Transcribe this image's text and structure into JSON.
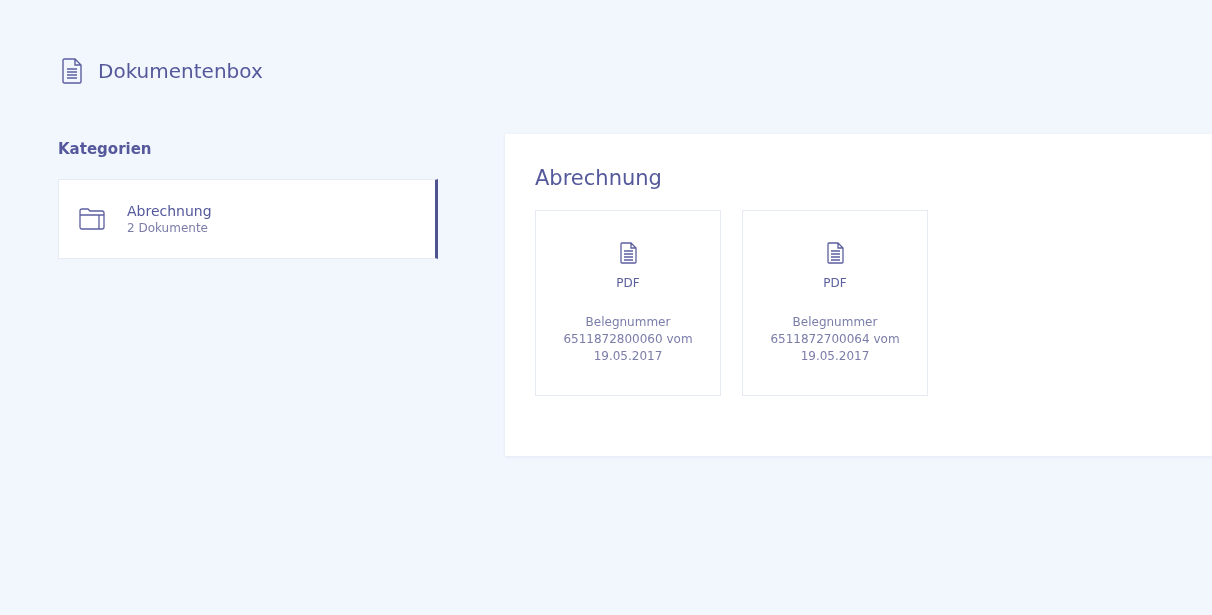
{
  "header": {
    "title": "Dokumentenbox"
  },
  "sidebar": {
    "heading": "Kategorien",
    "categories": [
      {
        "name": "Abrechnung",
        "count": "2 Dokumente",
        "selected": true
      }
    ]
  },
  "panel": {
    "title": "Abrechnung",
    "documents": [
      {
        "type": "PDF",
        "description": "Belegnummer 6511872800060 vom 19.05.2017"
      },
      {
        "type": "PDF",
        "description": "Belegnummer 6511872700064 vom 19.05.2017"
      }
    ]
  }
}
